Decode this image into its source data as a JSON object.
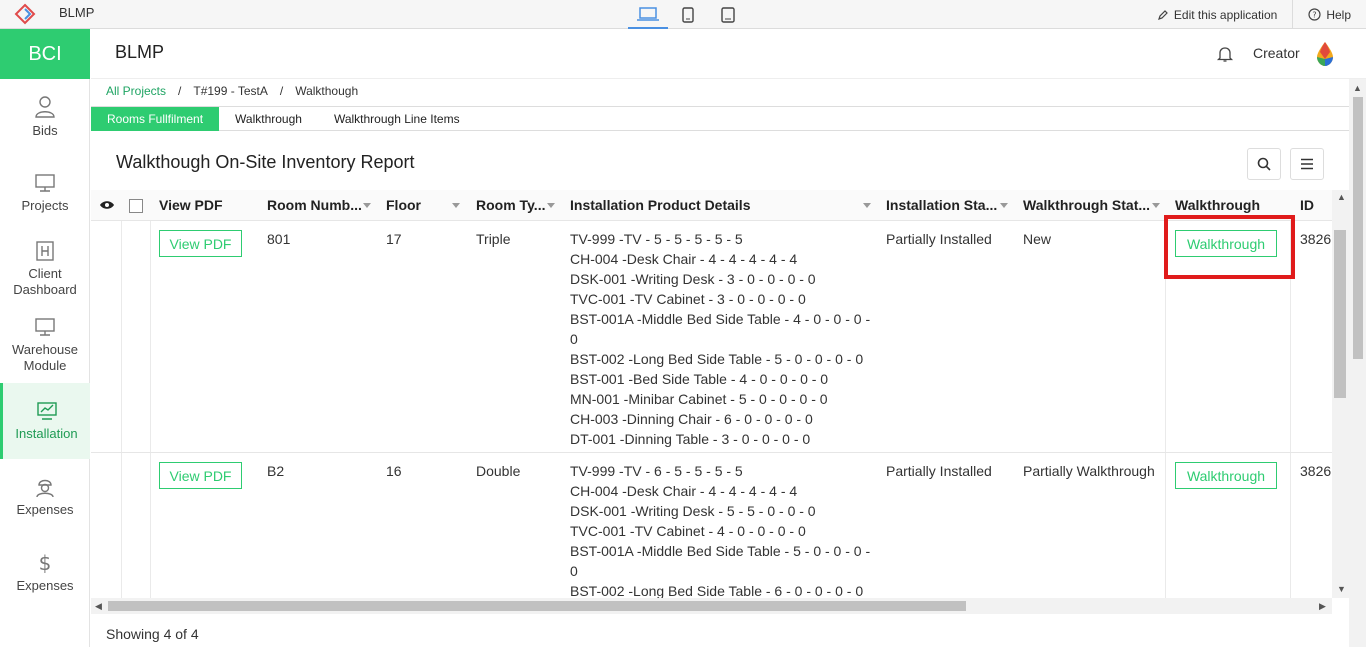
{
  "topbar": {
    "app_name": "BLMP",
    "edit_label": "Edit this application",
    "help_label": "Help"
  },
  "sidebar": {
    "brand": "BCI",
    "items": [
      {
        "label": "Bids",
        "icon": "user-icon"
      },
      {
        "label": "Projects",
        "icon": "monitor-icon"
      },
      {
        "label": "Client Dashboard",
        "icon": "building-icon"
      },
      {
        "label": "Warehouse Module",
        "icon": "monitor-icon"
      },
      {
        "label": "Installation",
        "icon": "chart-icon",
        "active": true
      },
      {
        "label": "Expenses",
        "icon": "worker-icon"
      },
      {
        "label": "Expenses",
        "icon": "dollar-icon"
      }
    ]
  },
  "header": {
    "title": "BLMP",
    "user": "Creator"
  },
  "breadcrumb": {
    "root": "All Projects",
    "project": "T#199 - TestA",
    "current": "Walkthough"
  },
  "tabs": [
    "Rooms Fullfilment",
    "Walkthrough",
    "Walkthrough Line Items"
  ],
  "report": {
    "title": "Walkthough On-Site Inventory Report"
  },
  "table": {
    "columns": [
      "View PDF",
      "Room Numb...",
      "Floor",
      "Room Ty...",
      "Installation Product Details",
      "Installation Sta...",
      "Walkthrough Stat...",
      "Walkthrough",
      "ID"
    ],
    "pdf_label": "View PDF",
    "walk_label": "Walkthrough",
    "rows": [
      {
        "room": "801",
        "floor": "17",
        "type": "Triple",
        "details": [
          "TV-999 -TV - 5 - 5 - 5 - 5 - 5",
          "CH-004 -Desk Chair - 4 - 4 - 4 - 4 - 4",
          "DSK-001 -Writing Desk - 3 - 0 - 0 - 0 - 0",
          "TVC-001 -TV Cabinet - 3 - 0 - 0 - 0 - 0",
          "BST-001A -Middle Bed Side Table - 4 - 0 - 0 - 0 -",
          "0",
          "BST-002 -Long Bed Side Table - 5 - 0 - 0 - 0 - 0",
          "BST-001 -Bed Side Table - 4 - 0 - 0 - 0 - 0",
          "MN-001 -Minibar Cabinet - 5 - 0 - 0 - 0 - 0",
          "CH-003 -Dinning Chair - 6 - 0 - 0 - 0 - 0",
          "DT-001 -Dinning Table - 3 - 0 - 0 - 0 - 0"
        ],
        "install_status": "Partially Installed",
        "walk_status": "New",
        "id": "3826"
      },
      {
        "room": "B2",
        "floor": "16",
        "type": "Double",
        "details": [
          "TV-999 -TV - 6 - 5 - 5 - 5 - 5",
          "CH-004 -Desk Chair - 4 - 4 - 4 - 4 - 4",
          "DSK-001 -Writing Desk - 5 - 5 - 0 - 0 - 0",
          "TVC-001 -TV Cabinet - 4 - 0 - 0 - 0 - 0",
          "BST-001A -Middle Bed Side Table - 5 - 0 - 0 - 0 -",
          "0",
          "BST-002 -Long Bed Side Table - 6 - 0 - 0 - 0 - 0"
        ],
        "install_status": "Partially Installed",
        "walk_status": "Partially Walkthrough",
        "id": "3826"
      }
    ]
  },
  "footer": {
    "showing": "Showing 4 of 4"
  },
  "colors": {
    "accent": "#2ecc71",
    "highlight": "#e01b1b"
  }
}
